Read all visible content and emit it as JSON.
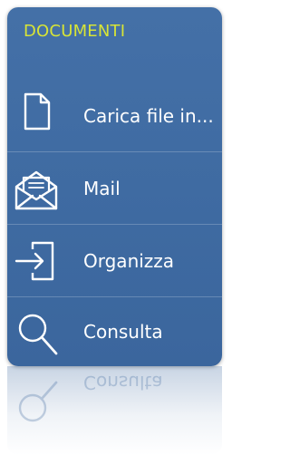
{
  "panel": {
    "title": "DOCUMENTI",
    "title_color": "#d7e436",
    "background_color": "#3f6ba2",
    "text_color": "#ffffff"
  },
  "menu": {
    "items": [
      {
        "label": "Carica file in...",
        "icon": "document-icon"
      },
      {
        "label": "Mail",
        "icon": "open-envelope-icon"
      },
      {
        "label": "Organizza",
        "icon": "sign-in-icon"
      },
      {
        "label": "Consulta",
        "icon": "magnifier-icon"
      }
    ]
  },
  "reflection": {
    "label": "Consulta"
  }
}
